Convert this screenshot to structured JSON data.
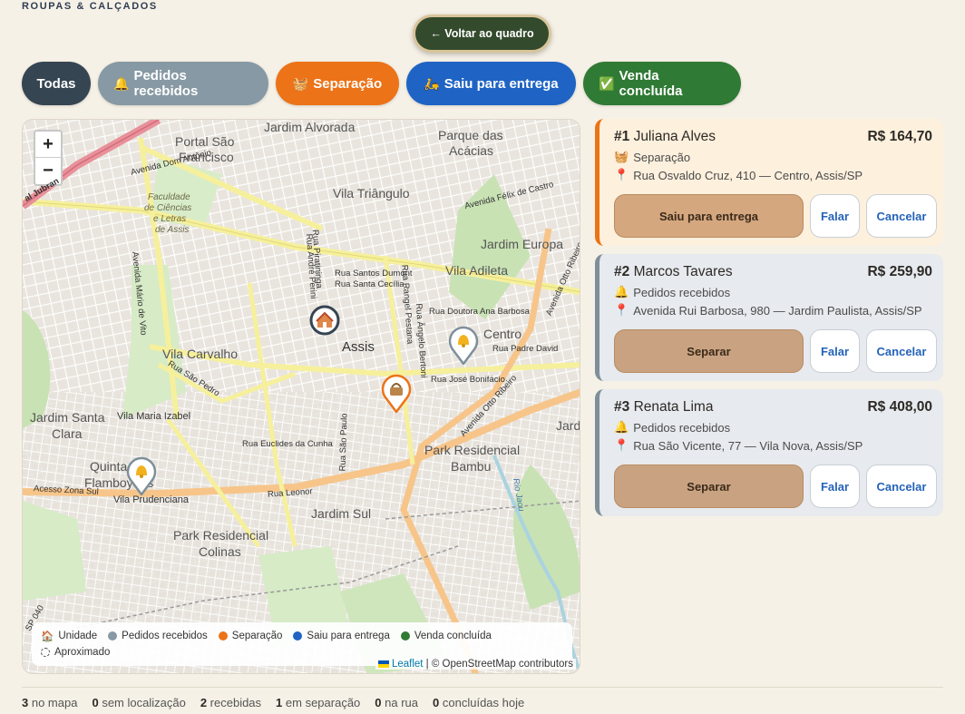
{
  "brand": "ROUPAS & CALÇADOS",
  "back_button": "← Voltar ao quadro",
  "filters": [
    {
      "label": "Todas",
      "icon": ""
    },
    {
      "label": "Pedidos recebidos",
      "icon": "bell-icon"
    },
    {
      "label": "Separação",
      "icon": "basket-icon"
    },
    {
      "label": "Saiu para entrega",
      "icon": "scooter-icon"
    },
    {
      "label": "Venda concluída",
      "icon": "check-icon"
    }
  ],
  "map": {
    "zoom_in": "+",
    "zoom_out": "−",
    "labels": {
      "jardim_alvorada": "Jardim Alvorada",
      "portal_sao_francisco_1": "Portal São",
      "portal_sao_francisco_2": "Francisco",
      "parque_acacias_1": "Parque das",
      "parque_acacias_2": "Acácias",
      "vila_triangulo": "Vila Triângulo",
      "jardim_europa": "Jardim Europa",
      "vila_adileta": "Vila Adileta",
      "vila_carvalho": "Vila Carvalho",
      "assis": "Assis",
      "centro": "Centro",
      "jardim_santa_clara_1": "Jardim Santa",
      "jardim_santa_clara_2": "Clara",
      "vila_maria_izabel": "Vila Maria Izabel",
      "quinta_1": "Quinta",
      "quinta_2": "Flamboyans",
      "vila_prudenciana": "Vila Prudenciana",
      "park_residencial_bambu_1": "Park Residencial",
      "park_residencial_bambu_2": "Bambu",
      "jardim_sul": "Jardim Sul",
      "park_residencial_colinas_1": "Park Residencial",
      "park_residencial_colinas_2": "Colinas",
      "jardim_right": "Jardim",
      "faculdade_1": "Faculdade",
      "faculdade_2": "de Ciências",
      "faculdade_3": "e Letras",
      "faculdade_4": "de Assis"
    },
    "streets": {
      "dom_antonio": "Avenida Dom Antônio",
      "felix_castro": "Avenida Félix de Castro",
      "santos_dumont": "Rua Santos Dumont",
      "santa_cecilia": "Rua Santa Cecília",
      "doutora_ana": "Rua Doutora Ana Barbosa",
      "padre_david": "Rua Padre David",
      "jose_bonifacio": "Rua José Bonifácio",
      "euclides": "Rua Euclides da Cunha",
      "leonor": "Rua Leonor",
      "acesso_zona_sul": "Acesso Zona Sul",
      "sao_pedro": "Rua São Pedro",
      "otto_ribeiro": "Avenida Otto Ribeiro",
      "otto_ribeiro_2": "Avenida Otto Ribeiro",
      "mario_vito": "Avenida Mário de Vito",
      "andre_perini": "Rua André Perini",
      "piratininga": "Rua Piratininga",
      "rangel_pestana": "Rua Rangel Pestana",
      "angelo_bertoni": "Rua Ângelo Bertoni",
      "sao_paulo": "Rua São Paulo",
      "jubran": "al Jubran",
      "rio_jacu": "Rio Jacu",
      "sp040": "SP 040"
    },
    "legend": {
      "unidade": "Unidade",
      "recebidos": "Pedidos recebidos",
      "separacao": "Separação",
      "entrega": "Saiu para entrega",
      "concluida": "Venda concluída",
      "aproximado": "Aproximado"
    },
    "attribution_leaflet": "Leaflet",
    "attribution_rest": " | © OpenStreetMap contributors"
  },
  "orders": [
    {
      "num": "#1",
      "name": "Juliana Alves",
      "price": "R$ 164,70",
      "status": "Separação",
      "address": "Rua Osvaldo Cruz, 410 — Centro, Assis/SP",
      "main_action": "Saiu para entrega",
      "talk": "Falar",
      "cancel": "Cancelar"
    },
    {
      "num": "#2",
      "name": "Marcos Tavares",
      "price": "R$ 259,90",
      "status": "Pedidos recebidos",
      "address": "Avenida Rui Barbosa, 980 — Jardim Paulista, Assis/SP",
      "main_action": "Separar",
      "talk": "Falar",
      "cancel": "Cancelar"
    },
    {
      "num": "#3",
      "name": "Renata Lima",
      "price": "R$ 408,00",
      "status": "Pedidos recebidos",
      "address": "Rua São Vicente, 77 — Vila Nova, Assis/SP",
      "main_action": "Separar",
      "talk": "Falar",
      "cancel": "Cancelar"
    }
  ],
  "stats": [
    {
      "value": "3",
      "label": "no mapa"
    },
    {
      "value": "0",
      "label": "sem localização"
    },
    {
      "value": "2",
      "label": "recebidas"
    },
    {
      "value": "1",
      "label": "em separação"
    },
    {
      "value": "0",
      "label": "na rua"
    },
    {
      "value": "0",
      "label": "concluídas hoje"
    }
  ],
  "colors": {
    "recebidos": "#8799a4",
    "separacao": "#ec7318",
    "entrega": "#1f64c4",
    "concluida": "#2f7a34",
    "unidade": "#364552"
  }
}
